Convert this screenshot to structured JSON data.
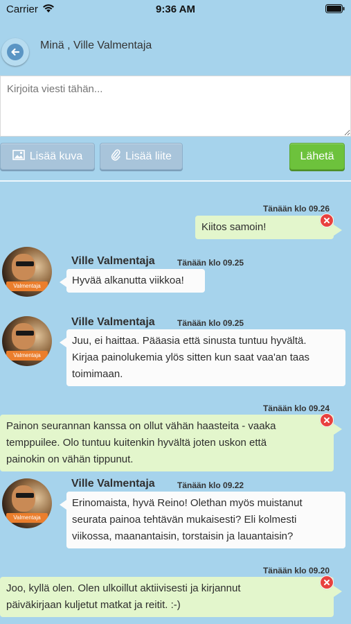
{
  "status_bar": {
    "carrier": "Carrier",
    "time": "9:36 AM"
  },
  "header": {
    "title": "Minä , Ville Valmentaja"
  },
  "compose": {
    "placeholder": "Kirjoita viesti tähän...",
    "add_image_label": "Lisää kuva",
    "add_attachment_label": "Lisää liite",
    "send_label": "Lähetä"
  },
  "messages": [
    {
      "sender": "",
      "own": true,
      "time": "Tänään klo 09.26",
      "text": "Kiitos samoin!"
    },
    {
      "sender": "Ville Valmentaja",
      "own": false,
      "badge": "Valmentaja",
      "time": "Tänään klo 09.25",
      "text": "Hyvää alkanutta viikkoa!"
    },
    {
      "sender": "Ville Valmentaja",
      "own": false,
      "badge": "Valmentaja",
      "time": "Tänään klo 09.25",
      "lines": [
        "Juu, ei haittaa. Pääasia että sinusta tuntuu hyvältä.",
        "Kirjaa painolukemia ylös sitten kun saat vaa'an taas",
        "toimimaan."
      ]
    },
    {
      "sender": "",
      "own": true,
      "time": "Tänään klo 09.24",
      "lines": [
        "Painon seurannan kanssa on ollut vähän haasteita - vaaka",
        "temppuilee. Olo tuntuu kuitenkin hyvältä joten uskon että",
        "painokin on vähän tippunut."
      ]
    },
    {
      "sender": "Ville Valmentaja",
      "own": false,
      "badge": "Valmentaja",
      "time": "Tänään klo 09.22",
      "lines": [
        "Erinomaista, hyvä Reino! Olethan myös muistanut",
        "seurata painoa tehtävän mukaisesti? Eli kolmesti",
        "viikossa, maanantaisin, torstaisin ja lauantaisin?"
      ]
    },
    {
      "sender": "",
      "own": true,
      "time": "Tänään klo 09.20",
      "lines": [
        "Joo, kyllä olen. Olen ulkoillut aktiivisesti ja kirjannut",
        "päiväkirjaan kuljetut matkat ja reitit. :-)"
      ]
    }
  ],
  "colors": {
    "background": "#a6d3ec",
    "own_bubble": "#e3f6cc",
    "send_button": "#6dc23c",
    "badge": "#eb7e2c",
    "delete": "#e8413f"
  },
  "icons": [
    "wifi-icon",
    "battery-icon",
    "back-arrow-icon",
    "image-icon",
    "paperclip-icon",
    "delete-icon"
  ]
}
